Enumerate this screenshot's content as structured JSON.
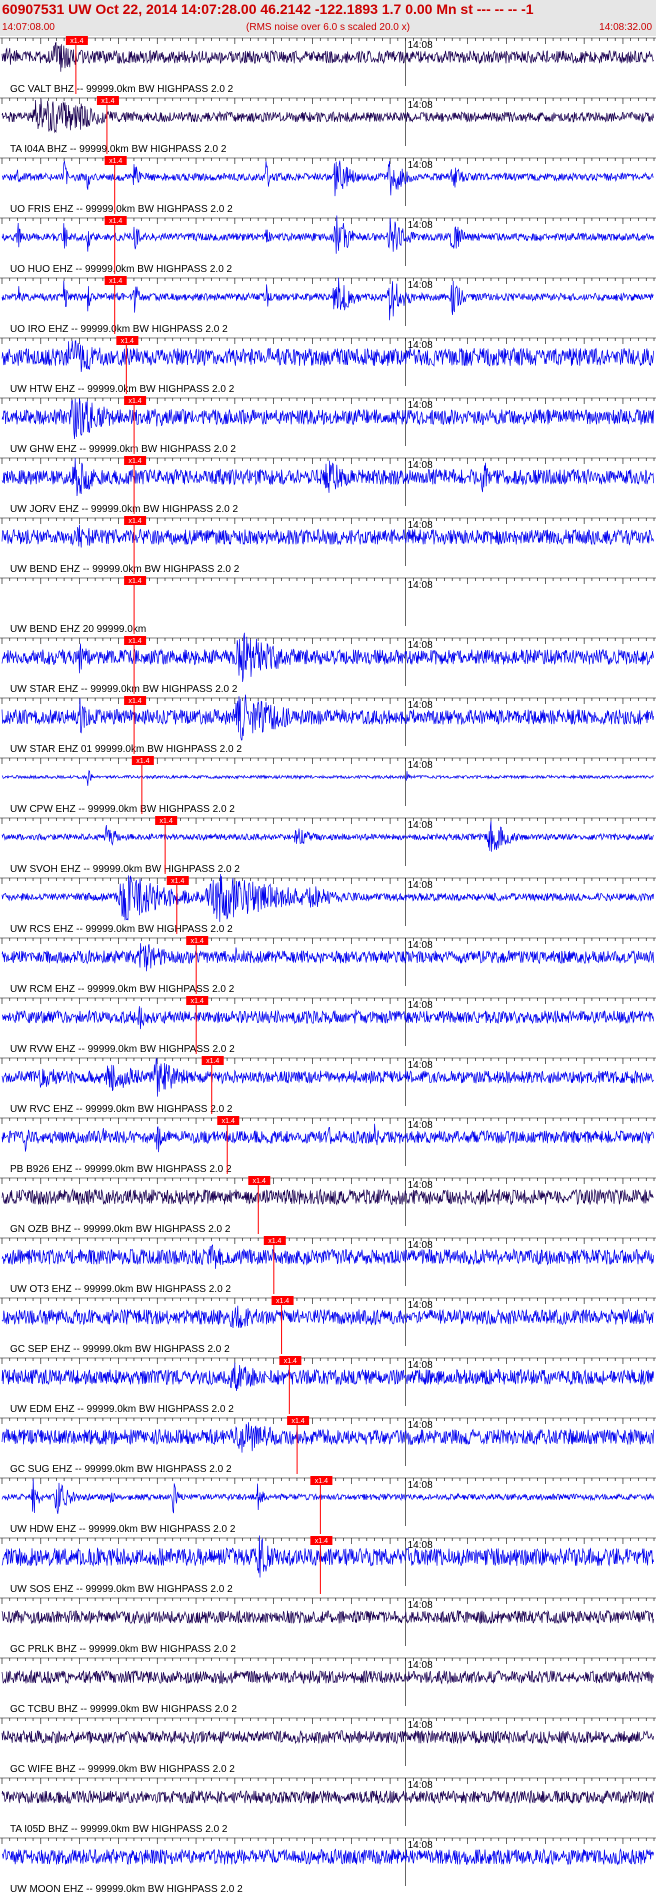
{
  "header": {
    "title": "60907531 UW Oct 22, 2014 14:07:28.00   46.2142 -122.1893  1.7 0.00 Mn st --- -- --   -1",
    "start_time": "14:07:08.00",
    "subtitle": "(RMS noise over 6.0 s scaled 20.0 x)",
    "end_time": "14:08:32.00"
  },
  "colors": {
    "title": "#cc0000",
    "header_bg": "#e6e6e6",
    "trace_blue": "#0000ee",
    "trace_dark": "#1a0050",
    "pick_line": "#ff0000",
    "pick_box": "#ff0000",
    "pick_text": "#ffffff",
    "axis": "#000000"
  },
  "chart_data": {
    "type": "seismogram",
    "time_start": "14:07:08.00",
    "time_end": "14:08:32.00",
    "time_axis_label": "14:08",
    "pick_label": "x1.4",
    "channels": [
      {
        "label": "GC VALT BHZ -- 99999.0km BW  HIGHPASS  2.0  2",
        "pick_s": 0.5,
        "color": "dark",
        "amp": 0.25,
        "bursts": [
          [
            7,
            3,
            0.7
          ],
          [
            0.5,
            2,
            0.5
          ]
        ]
      },
      {
        "label": "TA I04A BHZ -- 99999.0km BW  HIGHPASS  2.0  2",
        "pick_s": 4.5,
        "color": "dark",
        "amp": 0.2,
        "bursts": [
          [
            5,
            5,
            1.0
          ],
          [
            10,
            2,
            0.6
          ]
        ]
      },
      {
        "label": "UO FRIS EHZ -- 99999.0km BW  HIGHPASS  2.0  2",
        "pick_s": 5.5,
        "color": "blue",
        "amp": 0.15,
        "bursts": [
          [
            2,
            0.3,
            0.8
          ],
          [
            8,
            0.3,
            0.8
          ],
          [
            11,
            0.3,
            0.6
          ],
          [
            17,
            0.5,
            0.7
          ],
          [
            34,
            0.4,
            0.8
          ],
          [
            43,
            1.5,
            0.9
          ],
          [
            50,
            1.5,
            0.9
          ],
          [
            58,
            1,
            0.7
          ]
        ]
      },
      {
        "label": "UO HUO EHZ -- 99999.0km BW  HIGHPASS  2.0  2",
        "pick_s": 5.5,
        "color": "blue",
        "amp": 0.15,
        "bursts": [
          [
            2,
            0.3,
            0.8
          ],
          [
            8,
            0.3,
            0.8
          ],
          [
            11,
            0.3,
            0.7
          ],
          [
            17,
            0.5,
            0.8
          ],
          [
            34,
            0.4,
            0.8
          ],
          [
            43,
            1.5,
            1.0
          ],
          [
            50,
            1.5,
            1.0
          ],
          [
            58,
            1,
            0.8
          ]
        ]
      },
      {
        "label": "UO IRO EHZ -- 99999.0km BW  HIGHPASS  2.0  2",
        "pick_s": 5.5,
        "color": "blue",
        "amp": 0.15,
        "bursts": [
          [
            2,
            0.3,
            0.9
          ],
          [
            8,
            0.3,
            0.9
          ],
          [
            11,
            0.3,
            0.7
          ],
          [
            17,
            0.5,
            0.9
          ],
          [
            34,
            0.4,
            0.8
          ],
          [
            43,
            1.5,
            1.0
          ],
          [
            50,
            1.5,
            1.0
          ],
          [
            58,
            1,
            0.8
          ]
        ]
      },
      {
        "label": "UW HTW EHZ -- 99999.0km BW  HIGHPASS  2.0  2",
        "pick_s": 7.0,
        "color": "blue",
        "amp": 0.35,
        "bursts": [
          [
            9,
            4,
            0.8
          ]
        ]
      },
      {
        "label": "UW GHW EHZ -- 99999.0km BW  HIGHPASS  2.0  2",
        "pick_s": 8.0,
        "color": "blue",
        "amp": 0.3,
        "bursts": [
          [
            9.5,
            4,
            0.9
          ],
          [
            20,
            6,
            0.4
          ]
        ]
      },
      {
        "label": "UW JORV EHZ -- 99999.0km BW  HIGHPASS  2.0  2",
        "pick_s": 8.0,
        "color": "blue",
        "amp": 0.3,
        "bursts": [
          [
            9.5,
            2,
            1.0
          ],
          [
            42,
            3,
            0.7
          ],
          [
            62,
            1,
            0.8
          ]
        ]
      },
      {
        "label": "UW BEND EHZ -- 99999.0km BW  HIGHPASS  2.0  2",
        "pick_s": 8.0,
        "color": "blue",
        "amp": 0.3,
        "bursts": [
          [
            10,
            3,
            0.5
          ]
        ]
      },
      {
        "label": "UW BEND EHZ 20 99999.0km",
        "pick_s": 8.0,
        "color": "none",
        "amp": 0,
        "bursts": []
      },
      {
        "label": "UW STAR EHZ -- 99999.0km BW  HIGHPASS  2.0  2",
        "pick_s": 8.0,
        "color": "blue",
        "amp": 0.3,
        "bursts": [
          [
            10,
            1,
            0.7
          ],
          [
            31,
            5,
            1.0
          ]
        ]
      },
      {
        "label": "UW STAR EHZ 01 99999.0km BW  HIGHPASS  2.0  2",
        "pick_s": 8.0,
        "color": "blue",
        "amp": 0.3,
        "bursts": [
          [
            10,
            1,
            0.9
          ],
          [
            31,
            5,
            1.0
          ]
        ]
      },
      {
        "label": "UW CPW EHZ -- 99999.0km BW  HIGHPASS  2.0  2",
        "pick_s": 9.0,
        "color": "blue",
        "amp": 0.06,
        "bursts": [
          [
            11,
            0.3,
            0.5
          ],
          [
            52,
            0.3,
            0.4
          ]
        ]
      },
      {
        "label": "UW SVOH EHZ -- 99999.0km BW  HIGHPASS  2.0  2",
        "pick_s": 12.0,
        "color": "blue",
        "amp": 0.12,
        "bursts": [
          [
            13.5,
            1.5,
            0.5
          ],
          [
            38,
            2,
            0.4
          ],
          [
            63,
            2,
            0.7
          ]
        ]
      },
      {
        "label": "UW RCS EHZ -- 99999.0km BW  HIGHPASS  2.0  2",
        "pick_s": 13.5,
        "color": "blue",
        "amp": 0.15,
        "bursts": [
          [
            16,
            5,
            1.0
          ],
          [
            28,
            8,
            1.0
          ],
          [
            40,
            3,
            0.5
          ]
        ]
      },
      {
        "label": "UW RCM EHZ -- 99999.0km BW  HIGHPASS  2.0  2",
        "pick_s": 16.0,
        "color": "blue",
        "amp": 0.25,
        "bursts": [
          [
            18,
            3,
            0.7
          ],
          [
            30,
            3,
            0.4
          ]
        ]
      },
      {
        "label": "UW RVW EHZ -- 99999.0km BW  HIGHPASS  2.0  2",
        "pick_s": 16.0,
        "color": "blue",
        "amp": 0.25,
        "bursts": [
          [
            17.5,
            1,
            0.7
          ],
          [
            45,
            2,
            0.4
          ]
        ]
      },
      {
        "label": "UW RVC EHZ -- 99999.0km BW  HIGHPASS  2.0  2",
        "pick_s": 18.0,
        "color": "blue",
        "amp": 0.25,
        "bursts": [
          [
            14,
            4,
            0.6
          ],
          [
            20,
            3,
            0.8
          ],
          [
            5,
            3,
            0.5
          ]
        ]
      },
      {
        "label": "PB B926 EHZ -- 99999.0km BW  HIGHPASS  2.0  2",
        "pick_s": 20.0,
        "color": "blue",
        "amp": 0.25,
        "bursts": [
          [
            3,
            0.4,
            0.7
          ],
          [
            13,
            0.4,
            0.6
          ],
          [
            20,
            0.4,
            1.0
          ],
          [
            42,
            0.4,
            0.7
          ],
          [
            48,
            0.4,
            0.9
          ]
        ]
      },
      {
        "label": "GN OZB BHZ -- 99999.0km BW  HIGHPASS  2.0  2",
        "pick_s": 24.0,
        "color": "dark",
        "amp": 0.3,
        "bursts": []
      },
      {
        "label": "UW OT3 EHZ -- 99999.0km BW  HIGHPASS  2.0  2",
        "pick_s": 26.0,
        "color": "blue",
        "amp": 0.3,
        "bursts": [
          [
            27,
            2,
            0.6
          ]
        ]
      },
      {
        "label": "GC SEP EHZ -- 99999.0km BW  HIGHPASS  2.0  2",
        "pick_s": 27.0,
        "color": "blue",
        "amp": 0.3,
        "bursts": [
          [
            30,
            6,
            0.5
          ]
        ]
      },
      {
        "label": "UW EDM EHZ -- 99999.0km BW  HIGHPASS  2.0  2",
        "pick_s": 28.0,
        "color": "blue",
        "amp": 0.3,
        "bursts": [
          [
            30,
            4,
            0.6
          ]
        ]
      },
      {
        "label": "GC SUG EHZ -- 99999.0km BW  HIGHPASS  2.0  2",
        "pick_s": 29.0,
        "color": "blue",
        "amp": 0.3,
        "bursts": [
          [
            31,
            5,
            0.7
          ]
        ]
      },
      {
        "label": "UW HDW EHZ -- 99999.0km BW  HIGHPASS  2.0  2",
        "pick_s": 32.0,
        "color": "blue",
        "amp": 0.12,
        "bursts": [
          [
            4,
            0.6,
            0.9
          ],
          [
            7,
            1,
            0.9
          ],
          [
            8.5,
            0.8,
            0.7
          ],
          [
            14,
            0.3,
            0.6
          ],
          [
            22,
            0.4,
            0.8
          ],
          [
            33,
            0.4,
            1.0
          ]
        ]
      },
      {
        "label": "UW SOS EHZ -- 99999.0km BW  HIGHPASS  2.0  2",
        "pick_s": 32.0,
        "color": "blue",
        "amp": 0.35,
        "bursts": [
          [
            33,
            1.5,
            1.0
          ]
        ]
      },
      {
        "label": "GC PRLK BHZ -- 99999.0km BW  HIGHPASS  2.0  2",
        "pick_s": null,
        "color": "dark",
        "amp": 0.25,
        "bursts": []
      },
      {
        "label": "GC TCBU BHZ -- 99999.0km BW  HIGHPASS  2.0  2",
        "pick_s": null,
        "color": "dark",
        "amp": 0.25,
        "bursts": []
      },
      {
        "label": "GC WIFE BHZ -- 99999.0km BW  HIGHPASS  2.0  2",
        "pick_s": null,
        "color": "dark",
        "amp": 0.25,
        "bursts": []
      },
      {
        "label": "TA I05D BHZ -- 99999.0km BW  HIGHPASS  2.0  2",
        "pick_s": null,
        "color": "dark",
        "amp": 0.25,
        "bursts": []
      },
      {
        "label": "UW MOON EHZ -- 99999.0km BW  HIGHPASS  2.0  2",
        "pick_s": null,
        "color": "blue",
        "amp": 0.3,
        "bursts": []
      }
    ]
  }
}
